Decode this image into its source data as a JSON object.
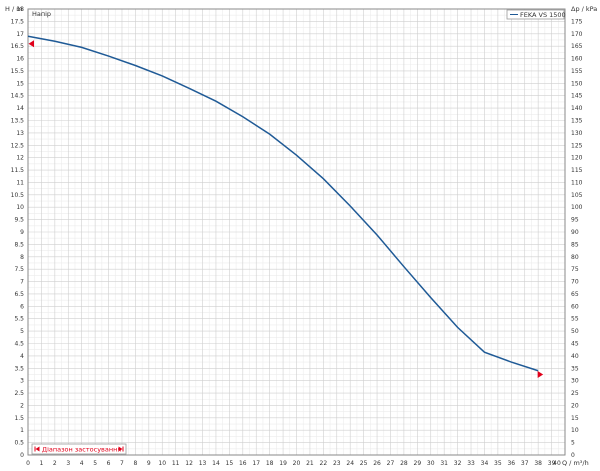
{
  "chart_data": {
    "type": "line",
    "y_left_label": "H / m",
    "y_right_label": "Δp / kPa",
    "x_label": "Q / m³/h",
    "xlim": [
      0,
      40
    ],
    "ylim_left": [
      0,
      18
    ],
    "ylim_right": [
      0,
      180
    ],
    "x_ticks": [
      0,
      1,
      2,
      3,
      4,
      5,
      6,
      7,
      8,
      9,
      10,
      11,
      12,
      13,
      14,
      15,
      16,
      17,
      18,
      19,
      20,
      21,
      22,
      23,
      24,
      25,
      26,
      27,
      28,
      29,
      30,
      31,
      32,
      33,
      34,
      35,
      36,
      37,
      38,
      39
    ],
    "x_ticks_last_label": "40",
    "y_left_ticks": [
      "0",
      "0.5",
      "1",
      "1.5",
      "2",
      "2.5",
      "3",
      "3.5",
      "4",
      "4.5",
      "5",
      "5.5",
      "6",
      "6.5",
      "7",
      "7.5",
      "8",
      "8.5",
      "9",
      "9.5",
      "10",
      "10.5",
      "11",
      "11.5",
      "12",
      "12.5",
      "13",
      "13.5",
      "14",
      "14.5",
      "15",
      "15.5",
      "16",
      "16.5",
      "17",
      "17.5"
    ],
    "y_left_top_tick": "18",
    "y_right_ticks": [
      "0",
      "5",
      "10",
      "15",
      "20",
      "25",
      "30",
      "35",
      "40",
      "45",
      "50",
      "55",
      "60",
      "65",
      "70",
      "75",
      "80",
      "85",
      "90",
      "95",
      "100",
      "105",
      "110",
      "115",
      "120",
      "125",
      "130",
      "135",
      "140",
      "145",
      "150",
      "155",
      "160",
      "165",
      "170",
      "175"
    ],
    "grid": true,
    "series": [
      {
        "name": "FEKA VS 1500",
        "color": "#1f5a96",
        "x": [
          0,
          2,
          4,
          6,
          8,
          10,
          12,
          14,
          16,
          18,
          20,
          22,
          24,
          26,
          28,
          30,
          32,
          34,
          36,
          38
        ],
        "y": [
          16.9,
          16.7,
          16.45,
          16.1,
          15.72,
          15.3,
          14.8,
          14.28,
          13.65,
          12.95,
          12.1,
          11.15,
          10.05,
          8.88,
          7.6,
          6.35,
          5.15,
          4.15,
          3.75,
          3.4
        ]
      }
    ],
    "annotations": {
      "series_label": "Напір",
      "legend_entry": "FEKA VS 1500",
      "range_label": "Діапазон застосування",
      "range_start_marker": {
        "x": 0,
        "y": 16.6
      },
      "range_end_marker": {
        "x": 38,
        "y": 3.25
      }
    },
    "colors": {
      "curve": "#1f5a96",
      "marker": "#e0001a",
      "grid_major": "#cfcfcf",
      "grid_minor": "#ececec",
      "axis": "#8a8a8a"
    }
  }
}
